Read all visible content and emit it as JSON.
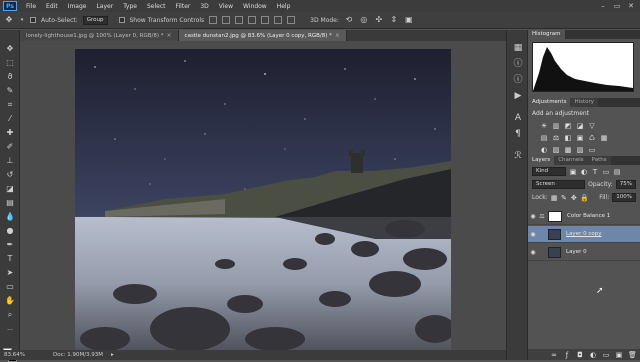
{
  "menubar": {
    "logo": "Ps",
    "items": [
      "File",
      "Edit",
      "Image",
      "Layer",
      "Type",
      "Select",
      "Filter",
      "3D",
      "View",
      "Window",
      "Help"
    ],
    "window_controls": [
      "–",
      "▭",
      "✕"
    ]
  },
  "options": {
    "auto_select_label": "Auto-Select:",
    "auto_select_value": "Group",
    "show_transform_label": "Show Transform Controls",
    "mode_3d_label": "3D Mode:"
  },
  "tabs": [
    {
      "label": "lonely-lighthouse1.jpg @ 100% (Layer 0, RGB/8) *",
      "active": false
    },
    {
      "label": "castle dunstan2.jpg @ 83.6% (Layer 0 copy, RGB/8) *",
      "active": true
    }
  ],
  "status": {
    "zoom": "83.64%",
    "doc": "Doc: 1.90M/3.93M"
  },
  "histogram": {
    "tab": "Histogram"
  },
  "adjustments": {
    "tabs": [
      "Adjustments",
      "History"
    ],
    "title": "Add an adjustment"
  },
  "layers_panel": {
    "tabs": [
      "Layers",
      "Channels",
      "Paths"
    ],
    "filter_kind": "Kind",
    "blend_mode": "Screen",
    "opacity_label": "Opacity:",
    "opacity_value": "75%",
    "lock_label": "Lock:",
    "fill_label": "Fill:",
    "fill_value": "100%",
    "layers": [
      {
        "name": "Color Balance 1",
        "selected": false
      },
      {
        "name": "Layer 0 copy",
        "selected": true
      },
      {
        "name": "Layer 0",
        "selected": false
      }
    ]
  }
}
